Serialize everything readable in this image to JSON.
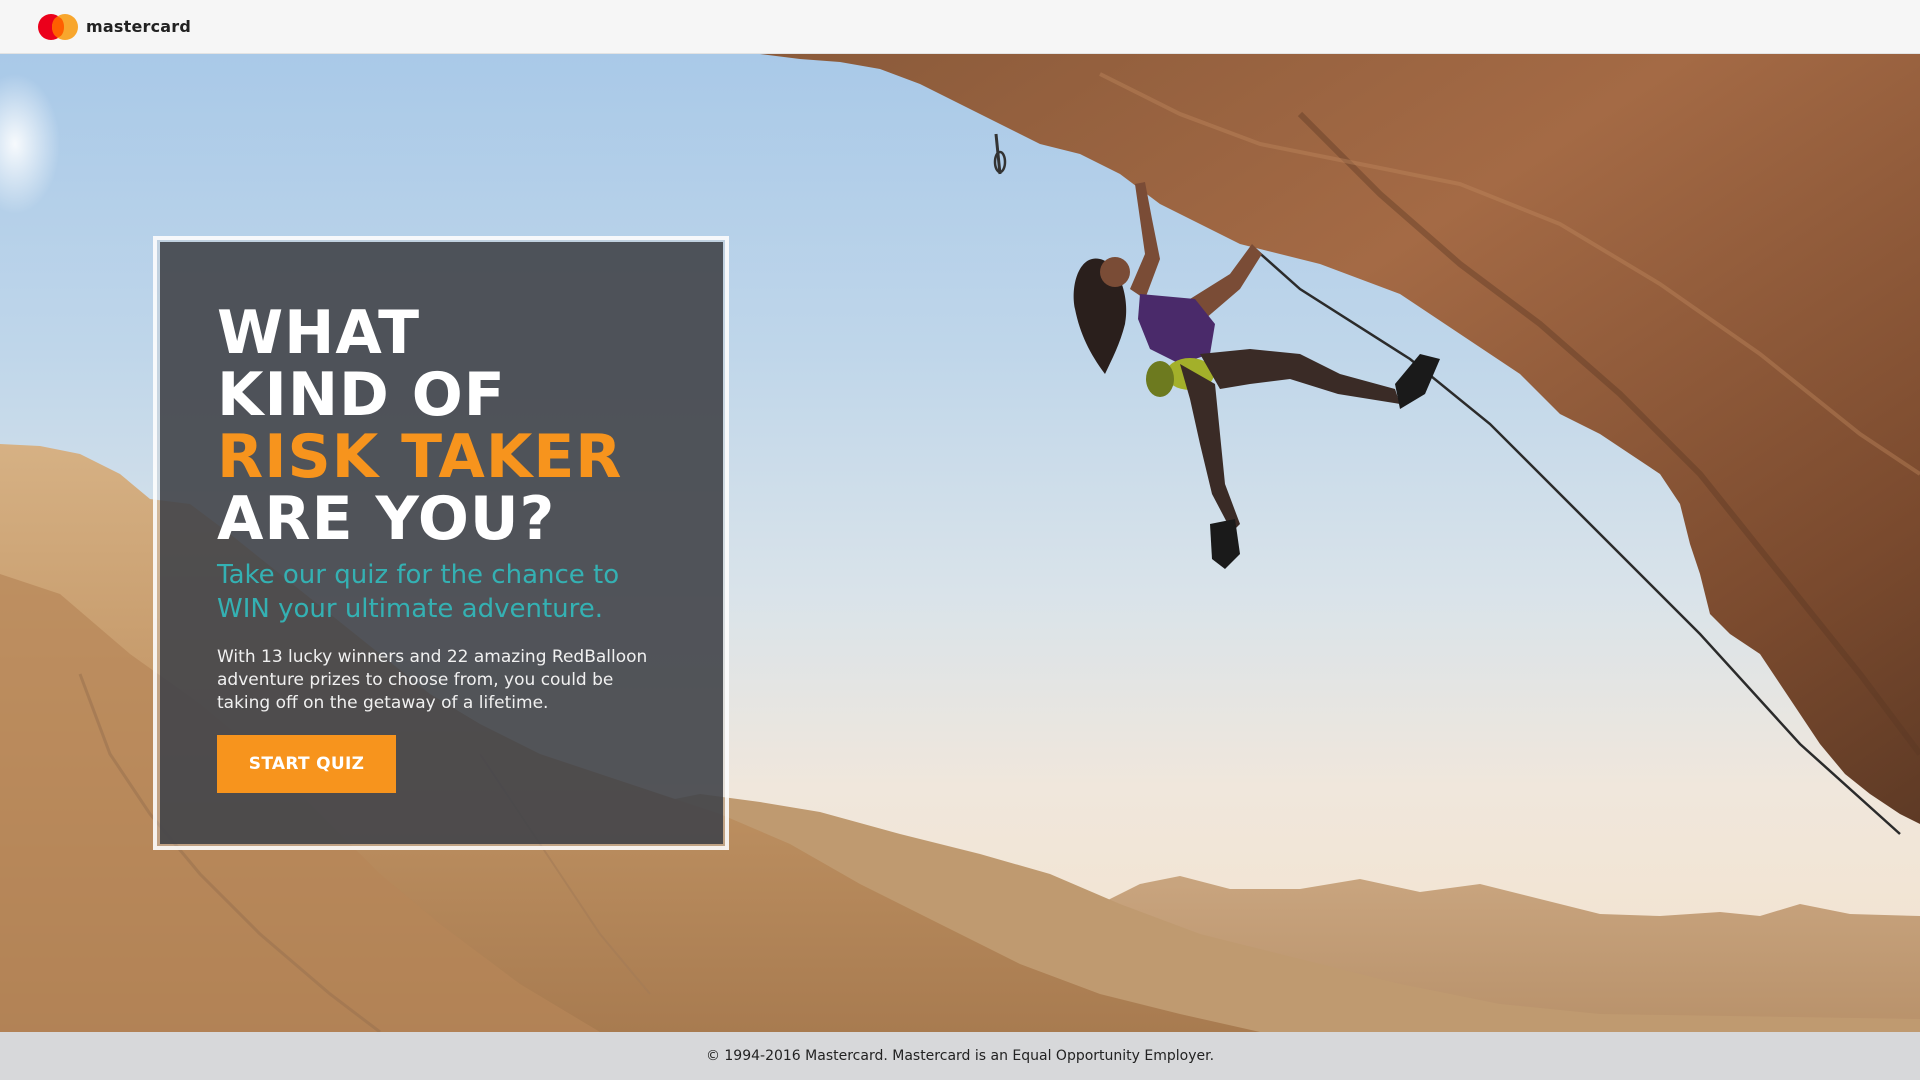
{
  "header": {
    "logo_text": "mastercard",
    "logo_colors": {
      "red": "#eb001b",
      "orange": "#f79e1b",
      "overlap": "#ff5f00"
    }
  },
  "hero": {
    "image_description_icon": "rock-climber-photo",
    "card": {
      "headline_lines": [
        "WHAT",
        "KIND OF",
        "RISK TAKER",
        "ARE YOU?"
      ],
      "subhead": "Take our quiz for the chance to WIN your ultimate adventure.",
      "body": "With 13 lucky winners and 22 amazing RedBalloon adventure prizes to choose from, you could be taking off on the getaway of a lifetime.",
      "cta_label": "START QUIZ"
    },
    "colors": {
      "accent": "#f7941d",
      "teal": "#34b1b3",
      "card_bg": "#3a3d42"
    }
  },
  "footer": {
    "text": "© 1994-2016 Mastercard. Mastercard is an Equal Opportunity Employer."
  }
}
